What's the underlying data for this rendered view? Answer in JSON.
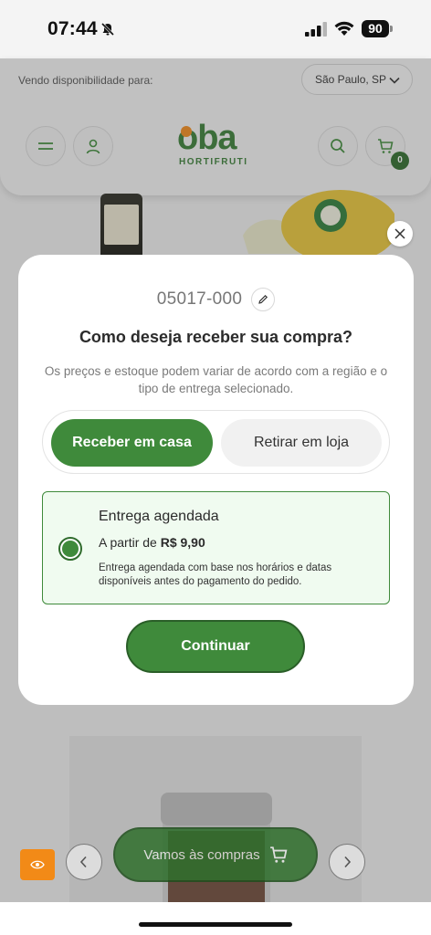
{
  "status_bar": {
    "time": "07:44",
    "battery": "90",
    "icons": [
      "bell-off-icon",
      "signal-icon",
      "wifi-icon",
      "battery-icon"
    ]
  },
  "header": {
    "availability_label": "Vendo disponibilidade para:",
    "city": "São Paulo, SP",
    "logo_text": "oba",
    "logo_subtitle": "HORTIFRUTI",
    "cart_count": "0",
    "icons": [
      "menu-icon",
      "user-icon",
      "search-icon",
      "cart-icon"
    ]
  },
  "modal": {
    "zip_code": "05017-000",
    "title": "Como deseja receber sua compra?",
    "description": "Os preços e estoque podem variar de acordo com a região e o tipo de entrega selecionado.",
    "delivery_tabs": [
      {
        "label": "Receber em casa",
        "selected": true
      },
      {
        "label": "Retirar em loja",
        "selected": false
      }
    ],
    "option": {
      "title": "Entrega agendada",
      "price_prefix": "A partir de",
      "price": "R$ 9,90",
      "description": "Entrega agendada com base nos horários e datas disponíveis antes do pagamento do pedido."
    },
    "continue_label": "Continuar"
  },
  "bottom": {
    "shop_button_label": "Vamos às compras"
  },
  "colors": {
    "brand_green": "#3f8a3b",
    "brand_orange": "#f08a1c",
    "option_bg": "#f0fbf0"
  }
}
